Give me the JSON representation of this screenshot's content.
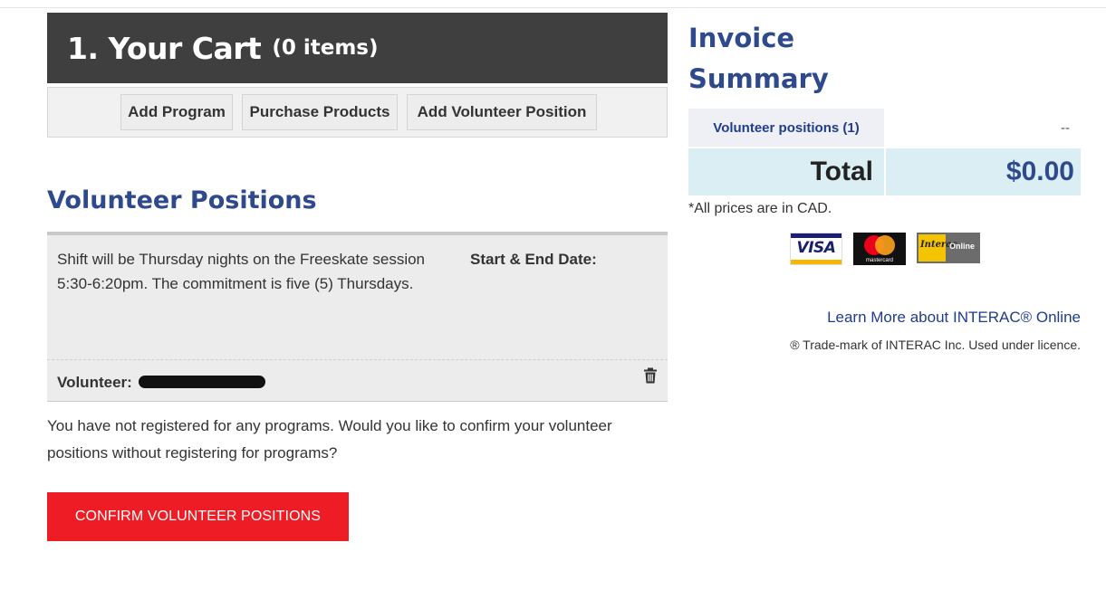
{
  "cart": {
    "title": "1. Your Cart",
    "count": "(0 items)",
    "actions": [
      {
        "label": "Add Program"
      },
      {
        "label": "Purchase Products"
      },
      {
        "label": "Add Volunteer Position"
      }
    ]
  },
  "volunteer_positions": {
    "heading": "Volunteer Positions",
    "item": {
      "description": "Shift will be Thursday nights on the Freeskate session 5:30-6:20pm. The commitment is five (5) Thursdays.",
      "date_label": "Start & End Date:",
      "volunteer_label": "Volunteer:"
    }
  },
  "notice": "You have not registered for any programs. Would you like to confirm your volunteer positions without registering for programs?",
  "confirm_button": "CONFIRM VOLUNTEER POSITIONS",
  "invoice": {
    "title": "Invoice Summary",
    "rows": [
      {
        "label": "Volunteer positions (1)",
        "value": "--"
      }
    ],
    "total_label": "Total",
    "total_value": "$0.00",
    "prices_note": "*All prices are in CAD."
  },
  "payment": {
    "logos": [
      {
        "name": "visa-logo",
        "text": "VISA"
      },
      {
        "name": "mastercard-logo",
        "text": "mastercard"
      },
      {
        "name": "interac-online-logo",
        "text": "Interac Online"
      }
    ],
    "learn_more": "Learn More about INTERAC® Online",
    "trademark": "® Trade-mark of INTERAC Inc. Used under licence."
  },
  "colors": {
    "brand_blue": "#2e4a8c",
    "header_bg": "#3f3f3f",
    "confirm_red": "#ee1c25",
    "total_bg": "#dbeef3"
  }
}
